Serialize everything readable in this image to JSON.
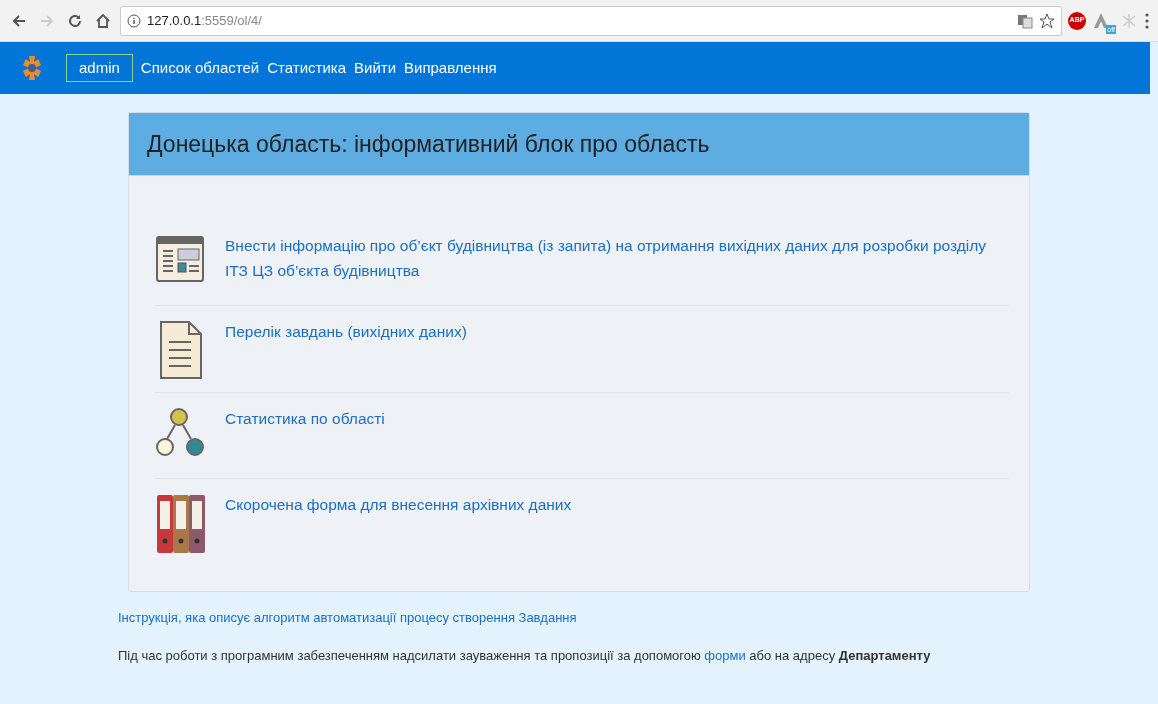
{
  "browser": {
    "url_host": "127.0.0.1",
    "url_path": ":5559/ol/4/",
    "forward_disabled": true,
    "adblock_label": "ABP",
    "extension_badge": "off"
  },
  "navbar": {
    "user": "admin",
    "links": [
      "Список областей",
      "Статистика",
      "Вийти",
      "Виправлення"
    ]
  },
  "card": {
    "title": "Донецька область: інформативний блок про область",
    "items": [
      {
        "kind": "form",
        "label": "Внести інформацію про об’єкт будівництва (із запита) на отримання вихідних даних для розробки розділу ІТЗ ЦЗ об’єкта будівництва"
      },
      {
        "kind": "document",
        "label": "Перелік завдань (вихідних даних)"
      },
      {
        "kind": "stats",
        "label": "Статистика по області"
      },
      {
        "kind": "folders",
        "label": "Скорочена форма для внесення архівних даних"
      }
    ]
  },
  "instruction_link": "Інструкція, яка описує алгоритм автоматизації процесу створення Завдання",
  "feedback": {
    "before": "Під час роботи з програмним забезпеченням надсилати зауваження та пропозиції за допомогою",
    "link": "форми",
    "after": "або на адресу **Департаменту**"
  }
}
